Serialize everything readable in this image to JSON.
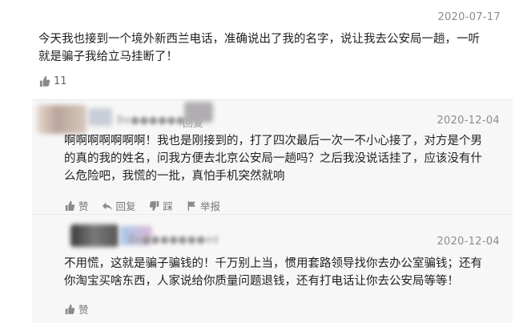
{
  "comment1": {
    "date": "2020-07-17",
    "text_line1": "今天我也接到一个境外新西兰电话，准确说出了我的名字，说让我去公安局一趟，一听",
    "text_line2": "就是骗子我给立马挂断了！",
    "like_count": "11"
  },
  "reply1": {
    "name": "Be●●●●●●ted",
    "reply_label": "回复",
    "date": "2020-12-04",
    "text_line1": "啊啊啊啊啊啊啊！我也是刚接到的，打了四次最后一次一不小心接了，对方是个男",
    "text_line2": "的真的我的姓名，问我方便去北京公安局一趟吗？之后我没说话挂了，应该没有什",
    "text_line3": "么危险吧，我慌的一批，真怕手机突然就响",
    "actions": {
      "like": "赞",
      "reply": "回复",
      "dislike": "踩",
      "report": "举报"
    }
  },
  "reply2": {
    "name": "Be●●●●●●●ed",
    "date": "2020-12-04",
    "text_line1": "不用慌，这就是骗子骗钱的！千万别上当，惯用套路领导找你去办公室骗钱；还有",
    "text_line2": "你淘宝买啥东西，人家说给你质量问题退钱，还有打电话让你去公安局等等！",
    "like_label": "赞"
  },
  "colors": {
    "text": "#1f1f1f",
    "meta": "#8c8c8c",
    "reply_bg": "#f7f7f7"
  },
  "icons": [
    "thumb-up-icon",
    "reply-icon",
    "thumb-down-icon",
    "flag-icon"
  ]
}
